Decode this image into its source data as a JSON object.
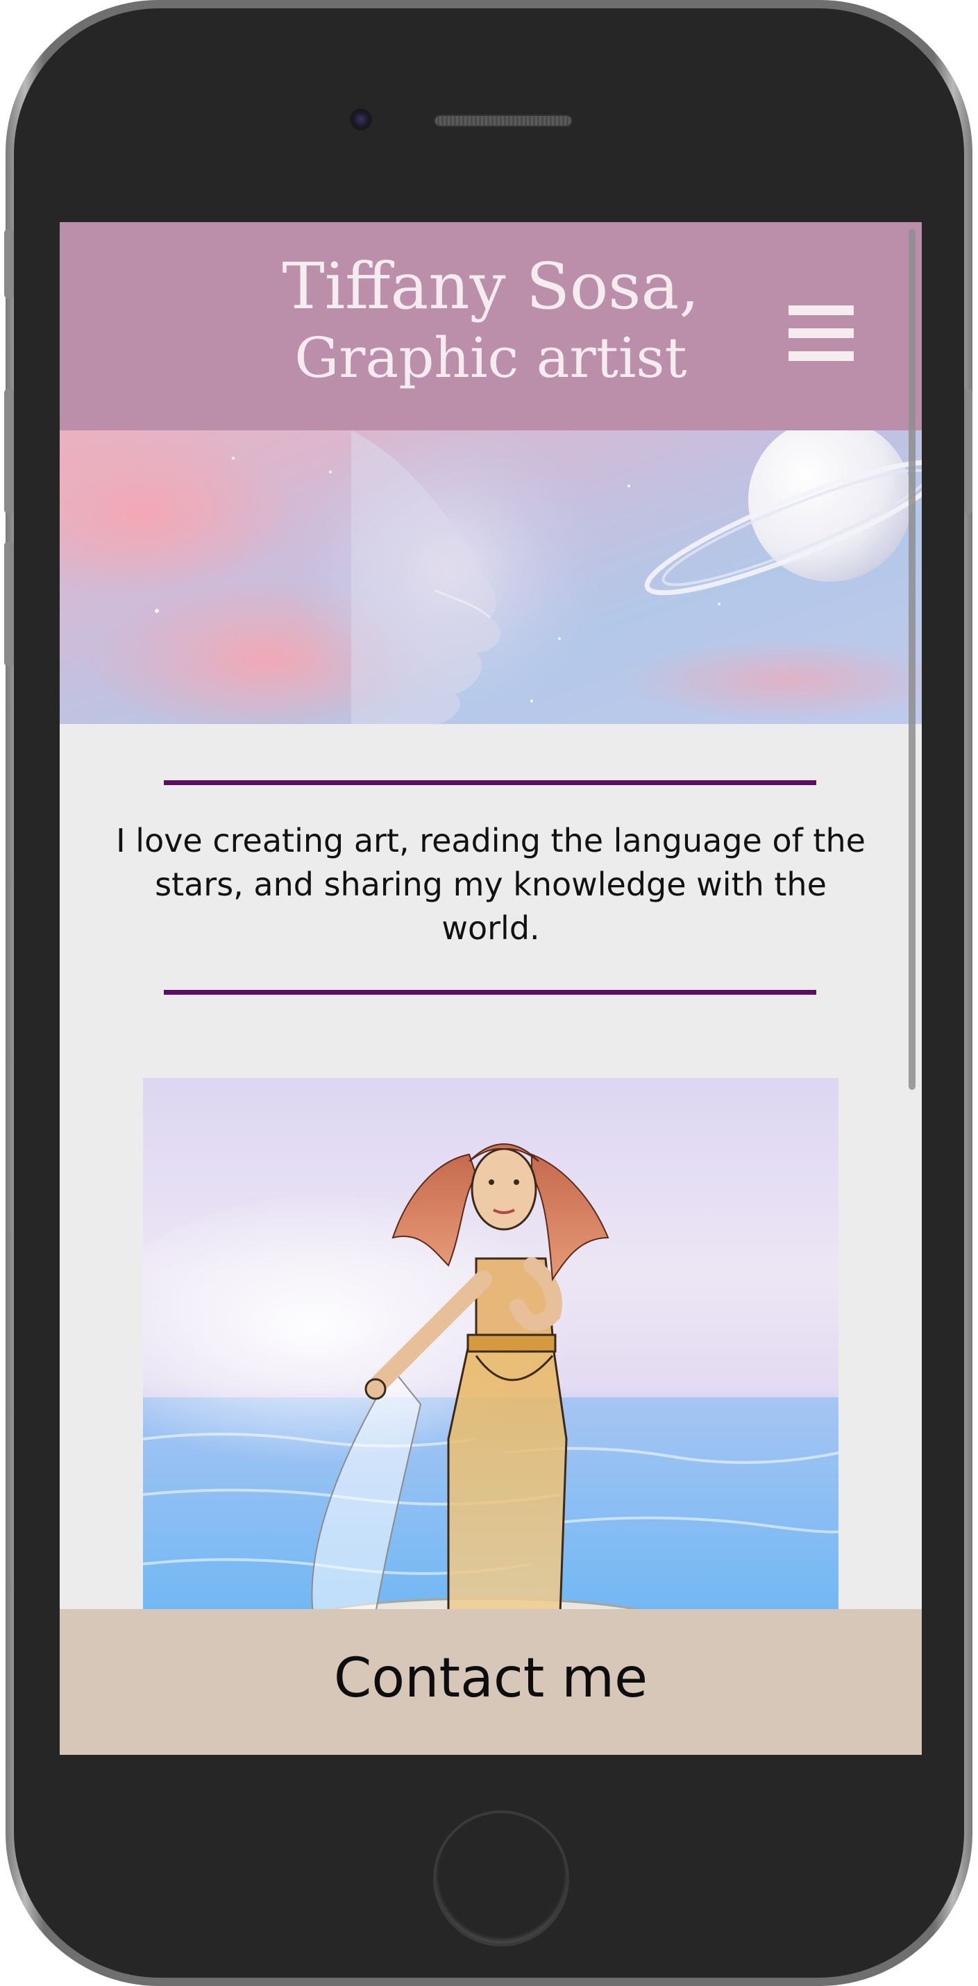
{
  "site": {
    "title_line1": "Tiffany Sosa,",
    "title_line2": "Graphic artist"
  },
  "header": {
    "menu_icon": "hamburger-menu-icon",
    "background_color": "#bb8fa9"
  },
  "hero": {
    "description": "Dreamy pastel sky with woman's face profile and ringed planet"
  },
  "intro": {
    "text": "I love creating art, reading the language of the stars, and sharing my knowledge with the world.",
    "rule_color": "#5b0f63"
  },
  "artwork": {
    "description": "Illustration of a red-haired woman in a sheer golden gown rising from the sea"
  },
  "contact": {
    "label": "Contact me",
    "background_color": "#d6c7b9"
  }
}
